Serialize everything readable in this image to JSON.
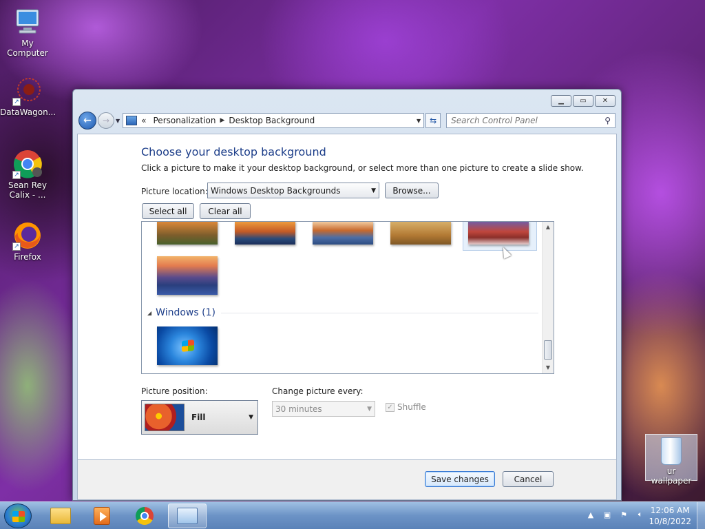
{
  "desktop": {
    "icons": [
      {
        "label": "My Computer",
        "icon": "computer-icon"
      },
      {
        "label": "DataWagon...",
        "icon": "datawagon-shortcut-icon"
      },
      {
        "label": "Sean Rey Calix - ...",
        "icon": "chrome-profile-shortcut-icon"
      },
      {
        "label": "Firefox",
        "icon": "firefox-shortcut-icon"
      }
    ],
    "recycle_bin": {
      "label": "ur wallpaper",
      "icon": "recycle-bin-icon"
    }
  },
  "window": {
    "controls": {
      "minimize": "minimize-icon",
      "maximize": "maximize-icon",
      "close": "close-icon"
    },
    "navigation": {
      "address_prefix": "«",
      "breadcrumbs": [
        "Personalization",
        "Desktop Background"
      ],
      "search_placeholder": "Search Control Panel"
    },
    "heading": "Choose your desktop background",
    "subtext": "Click a picture to make it your desktop background, or select more than one picture to create a slide show.",
    "picture_location": {
      "label": "Picture location:",
      "value": "Windows Desktop Backgrounds",
      "browse_label": "Browse..."
    },
    "select_all_label": "Select all",
    "clear_all_label": "Clear all",
    "gallery": {
      "group_title": "Windows (1)",
      "thumbnails_top_row": 5,
      "selected_index": 4
    },
    "picture_position": {
      "label": "Picture position:",
      "value": "Fill"
    },
    "change_picture": {
      "label": "Change picture every:",
      "value": "30 minutes"
    },
    "shuffle_label": "Shuffle",
    "save_label": "Save changes",
    "cancel_label": "Cancel"
  },
  "taskbar": {
    "pinned": [
      "windows-explorer-icon",
      "media-player-icon",
      "chrome-icon",
      "control-panel-icon"
    ],
    "clock_time": "12:06 AM",
    "clock_date": "10/8/2022"
  }
}
